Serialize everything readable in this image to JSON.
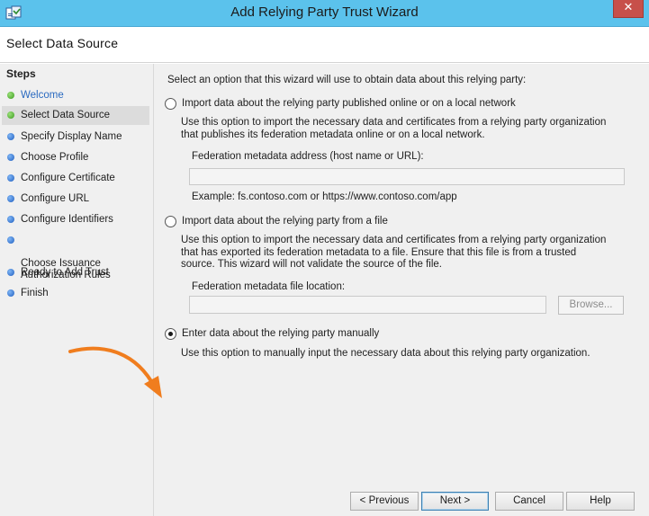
{
  "window": {
    "title": "Add Relying Party Trust Wizard",
    "close_glyph": "✕",
    "icon": "wizard-app-icon",
    "accent_color": "#5bc2ec",
    "close_color": "#c7504a"
  },
  "header": {
    "title": "Select Data Source"
  },
  "steps": {
    "title": "Steps",
    "items": [
      {
        "label": "Welcome",
        "state": "done",
        "dot": "green-dot-icon"
      },
      {
        "label": "Select Data Source",
        "state": "current",
        "dot": "green-dot-icon"
      },
      {
        "label": "Specify Display Name",
        "state": "pending",
        "dot": "blue-dot-icon"
      },
      {
        "label": "Choose Profile",
        "state": "pending",
        "dot": "blue-dot-icon"
      },
      {
        "label": "Configure Certificate",
        "state": "pending",
        "dot": "blue-dot-icon"
      },
      {
        "label": "Configure URL",
        "state": "pending",
        "dot": "blue-dot-icon"
      },
      {
        "label": "Configure Identifiers",
        "state": "pending",
        "dot": "blue-dot-icon"
      },
      {
        "label": "Choose Issuance\nAuthorization Rules",
        "state": "pending",
        "dot": "blue-dot-icon"
      },
      {
        "label": "Ready to Add Trust",
        "state": "pending",
        "dot": "blue-dot-icon"
      },
      {
        "label": "Finish",
        "state": "pending",
        "dot": "blue-dot-icon"
      }
    ]
  },
  "content": {
    "intro": "Select an option that this wizard will use to obtain data about this relying party:",
    "options": [
      {
        "label": "Import data about the relying party published online or on a local network",
        "checked": false,
        "description": "Use this option to import the necessary data and certificates from a relying party organization that publishes its federation metadata online or on a local network.",
        "field_label": "Federation metadata address (host name or URL):",
        "field_value": "",
        "example": "Example: fs.contoso.com or https://www.contoso.com/app"
      },
      {
        "label": "Import data about the relying party from a file",
        "checked": false,
        "description": "Use this option to import the necessary data and certificates from a relying party organization that has exported its federation metadata to a file. Ensure that this file is from a trusted source.  This wizard will not validate the source of the file.",
        "field_label": "Federation metadata file location:",
        "field_value": "",
        "browse_label": "Browse..."
      },
      {
        "label": "Enter data about the relying party manually",
        "checked": true,
        "description": "Use this option to manually input the necessary data about this relying party organization."
      }
    ]
  },
  "footer": {
    "previous_label": "< Previous",
    "next_label": "Next >",
    "cancel_label": "Cancel",
    "help_label": "Help"
  },
  "annotation": {
    "icon": "orange-arrow-icon",
    "color": "#f07d1e"
  }
}
